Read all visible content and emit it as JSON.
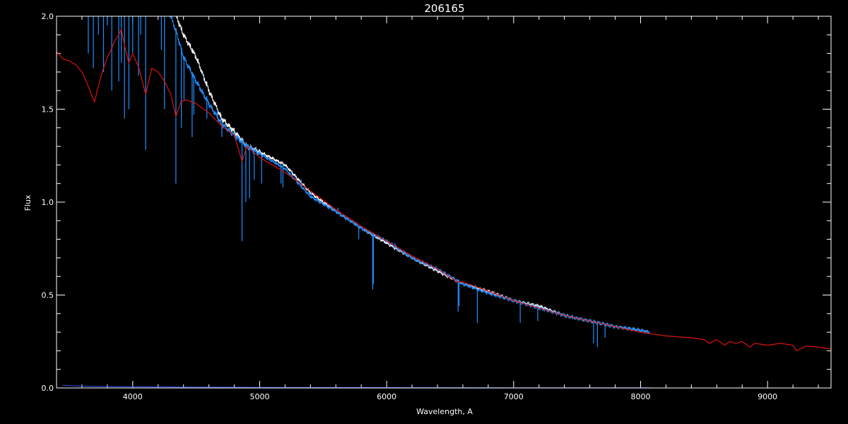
{
  "chart_data": {
    "type": "line",
    "title": "206165",
    "xlabel": "Wavelength, A",
    "ylabel": "Flux",
    "xlim": [
      3400,
      9500
    ],
    "ylim": [
      0.0,
      2.0
    ],
    "x_ticks": [
      4000,
      5000,
      6000,
      7000,
      8000,
      9000
    ],
    "x_tick_labels": [
      "4000",
      "5000",
      "6000",
      "7000",
      "8000",
      "9000"
    ],
    "y_ticks": [
      0.0,
      0.5,
      1.0,
      1.5,
      2.0
    ],
    "y_tick_labels": [
      "0.0",
      "0.5",
      "1.0",
      "1.5",
      "2.0"
    ],
    "grid": false,
    "background": "#000000",
    "series": [
      {
        "color": "#ffffff",
        "x": [
          3500,
          3600,
          3700,
          3800,
          3900,
          4000,
          4100,
          4200,
          4300,
          4350,
          4400,
          4500,
          4600,
          4700,
          4800,
          4900,
          5000,
          5200,
          5400,
          5600,
          5800,
          6000,
          6200,
          6400,
          6600,
          6800,
          7000,
          7200,
          7400,
          7600,
          7800,
          8000,
          8070
        ],
        "y": [
          2.2,
          2.2,
          2.2,
          2.2,
          2.2,
          2.2,
          2.2,
          2.15,
          2.05,
          1.99,
          1.9,
          1.78,
          1.6,
          1.45,
          1.38,
          1.3,
          1.27,
          1.2,
          1.05,
          0.95,
          0.86,
          0.78,
          0.7,
          0.63,
          0.56,
          0.52,
          0.47,
          0.44,
          0.39,
          0.36,
          0.33,
          0.31,
          0.3
        ],
        "dips": []
      },
      {
        "color": "#1e8fff",
        "x": [
          3500,
          3600,
          3700,
          3800,
          3900,
          4000,
          4100,
          4200,
          4250,
          4300,
          4350,
          4400,
          4500,
          4600,
          4700,
          4800,
          4900,
          5000,
          5200,
          5400,
          5600,
          5800,
          6000,
          6200,
          6400,
          6600,
          6800,
          7000,
          7200,
          7400,
          7600,
          7800,
          8000,
          8070
        ],
        "y": [
          2.2,
          2.2,
          2.2,
          2.2,
          2.2,
          2.2,
          2.2,
          2.2,
          2.1,
          2.0,
          1.9,
          1.78,
          1.65,
          1.53,
          1.42,
          1.36,
          1.3,
          1.26,
          1.18,
          1.03,
          0.95,
          0.86,
          0.79,
          0.7,
          0.64,
          0.56,
          0.51,
          0.47,
          0.43,
          0.39,
          0.36,
          0.33,
          0.31,
          0.3
        ],
        "dips": [
          [
            3650,
            1.8
          ],
          [
            3690,
            1.72
          ],
          [
            3730,
            1.9
          ],
          [
            3770,
            1.7
          ],
          [
            3800,
            1.95
          ],
          [
            3835,
            1.6
          ],
          [
            3890,
            1.65
          ],
          [
            3910,
            1.75
          ],
          [
            3935,
            1.45
          ],
          [
            3970,
            1.5
          ],
          [
            4000,
            1.8
          ],
          [
            4046,
            1.68
          ],
          [
            4063,
            1.9
          ],
          [
            4102,
            1.28
          ],
          [
            4226,
            1.82
          ],
          [
            4250,
            1.5
          ],
          [
            4340,
            1.1
          ],
          [
            4383,
            1.4
          ],
          [
            4404,
            1.55
          ],
          [
            4468,
            1.35
          ],
          [
            4481,
            1.47
          ],
          [
            4528,
            1.6
          ],
          [
            4549,
            1.58
          ],
          [
            4584,
            1.45
          ],
          [
            4668,
            1.5
          ],
          [
            4702,
            1.35
          ],
          [
            4861,
            0.79
          ],
          [
            4891,
            1.0
          ],
          [
            4920,
            1.02
          ],
          [
            4957,
            1.12
          ],
          [
            5015,
            1.1
          ],
          [
            5168,
            1.1
          ],
          [
            5183,
            1.08
          ],
          [
            5270,
            1.13
          ],
          [
            5328,
            1.12
          ],
          [
            5406,
            1.06
          ],
          [
            5455,
            1.01
          ],
          [
            5616,
            0.97
          ],
          [
            5711,
            0.9
          ],
          [
            5780,
            0.8
          ],
          [
            5890,
            0.53
          ],
          [
            5896,
            0.56
          ],
          [
            6065,
            0.78
          ],
          [
            6140,
            0.74
          ],
          [
            6163,
            0.72
          ],
          [
            6563,
            0.41
          ],
          [
            6570,
            0.44
          ],
          [
            6714,
            0.35
          ],
          [
            7052,
            0.35
          ],
          [
            7190,
            0.36
          ],
          [
            7630,
            0.24
          ],
          [
            7660,
            0.22
          ],
          [
            7720,
            0.27
          ]
        ]
      },
      {
        "color": "#dd1111",
        "x": [
          3400,
          3450,
          3500,
          3550,
          3600,
          3640,
          3680,
          3700,
          3720,
          3760,
          3800,
          3830,
          3860,
          3890,
          3910,
          3940,
          3970,
          4000,
          4050,
          4102,
          4150,
          4200,
          4250,
          4300,
          4340,
          4380,
          4420,
          4500,
          4600,
          4700,
          4800,
          4861,
          4900,
          5000,
          5200,
          5400,
          5600,
          5800,
          6000,
          6200,
          6400,
          6563,
          6600,
          6800,
          7000,
          7200,
          7400,
          7600,
          7800,
          8000,
          8200,
          8400,
          8500,
          8542,
          8600,
          8662,
          8700,
          8750,
          8800,
          8860,
          8900,
          9000,
          9100,
          9200,
          9229,
          9300,
          9400,
          9500
        ],
        "y": [
          1.81,
          1.77,
          1.76,
          1.74,
          1.7,
          1.64,
          1.57,
          1.54,
          1.6,
          1.7,
          1.78,
          1.82,
          1.87,
          1.9,
          1.93,
          1.83,
          1.75,
          1.8,
          1.72,
          1.58,
          1.72,
          1.7,
          1.65,
          1.58,
          1.46,
          1.54,
          1.55,
          1.53,
          1.48,
          1.41,
          1.36,
          1.22,
          1.3,
          1.24,
          1.16,
          1.06,
          0.96,
          0.87,
          0.79,
          0.71,
          0.64,
          0.57,
          0.57,
          0.52,
          0.47,
          0.43,
          0.39,
          0.36,
          0.33,
          0.3,
          0.28,
          0.27,
          0.26,
          0.24,
          0.26,
          0.23,
          0.25,
          0.24,
          0.25,
          0.22,
          0.24,
          0.23,
          0.24,
          0.23,
          0.2,
          0.225,
          0.22,
          0.21
        ],
        "dips": []
      },
      {
        "color": "#3355ff",
        "x": [
          3450,
          3500,
          3600,
          3700,
          4000,
          4500,
          5000,
          6000,
          7000,
          8000,
          8070
        ],
        "y": [
          0.015,
          0.012,
          0.01,
          0.008,
          0.006,
          0.004,
          0.003,
          0.002,
          0.001,
          0.001,
          0.001
        ],
        "dips": []
      }
    ]
  }
}
